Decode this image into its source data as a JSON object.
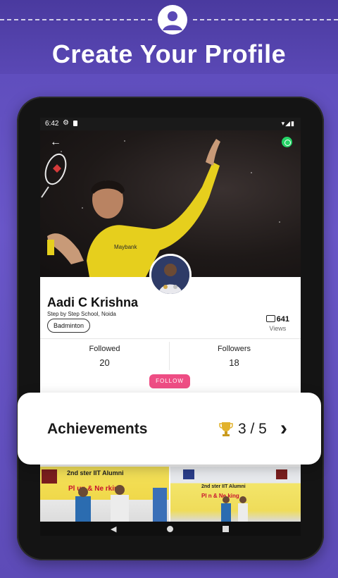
{
  "header": {
    "title": "Create Your Profile",
    "icon": "user-circle-icon"
  },
  "statusbar": {
    "time": "6:42",
    "icons": [
      "settings-icon",
      "sim-icon",
      "wifi-icon",
      "signal-icon",
      "battery-icon"
    ]
  },
  "hero": {
    "back_icon": "arrow-left-icon",
    "share_icon": "whatsapp-icon"
  },
  "profile": {
    "name": "Aadi C Krishna",
    "school": "Step by Step School, Noida",
    "sport": "Badminton",
    "views_count": "641",
    "views_label": "Views"
  },
  "stats": [
    {
      "label": "Followed",
      "value": "20"
    },
    {
      "label": "Followers",
      "value": "18"
    }
  ],
  "follow_button": "FOLLOW",
  "achievements": {
    "title": "Achievements",
    "count": "3 / 5",
    "icon": "trophy-icon",
    "arrow_icon": "chevron-right-icon"
  },
  "gallery": {
    "photos": [
      {
        "banner_line1": "2nd ster IIT Alumni",
        "banner_line2": "Pl un & Ne rking"
      },
      {
        "banner_line1": "2nd ster IIT Alumni",
        "banner_line2": "Pl n & Ne king"
      }
    ]
  },
  "colors": {
    "accent": "#ee4d84",
    "background": "#5b4ab8",
    "badminton_shirt": "#e8d21e"
  }
}
